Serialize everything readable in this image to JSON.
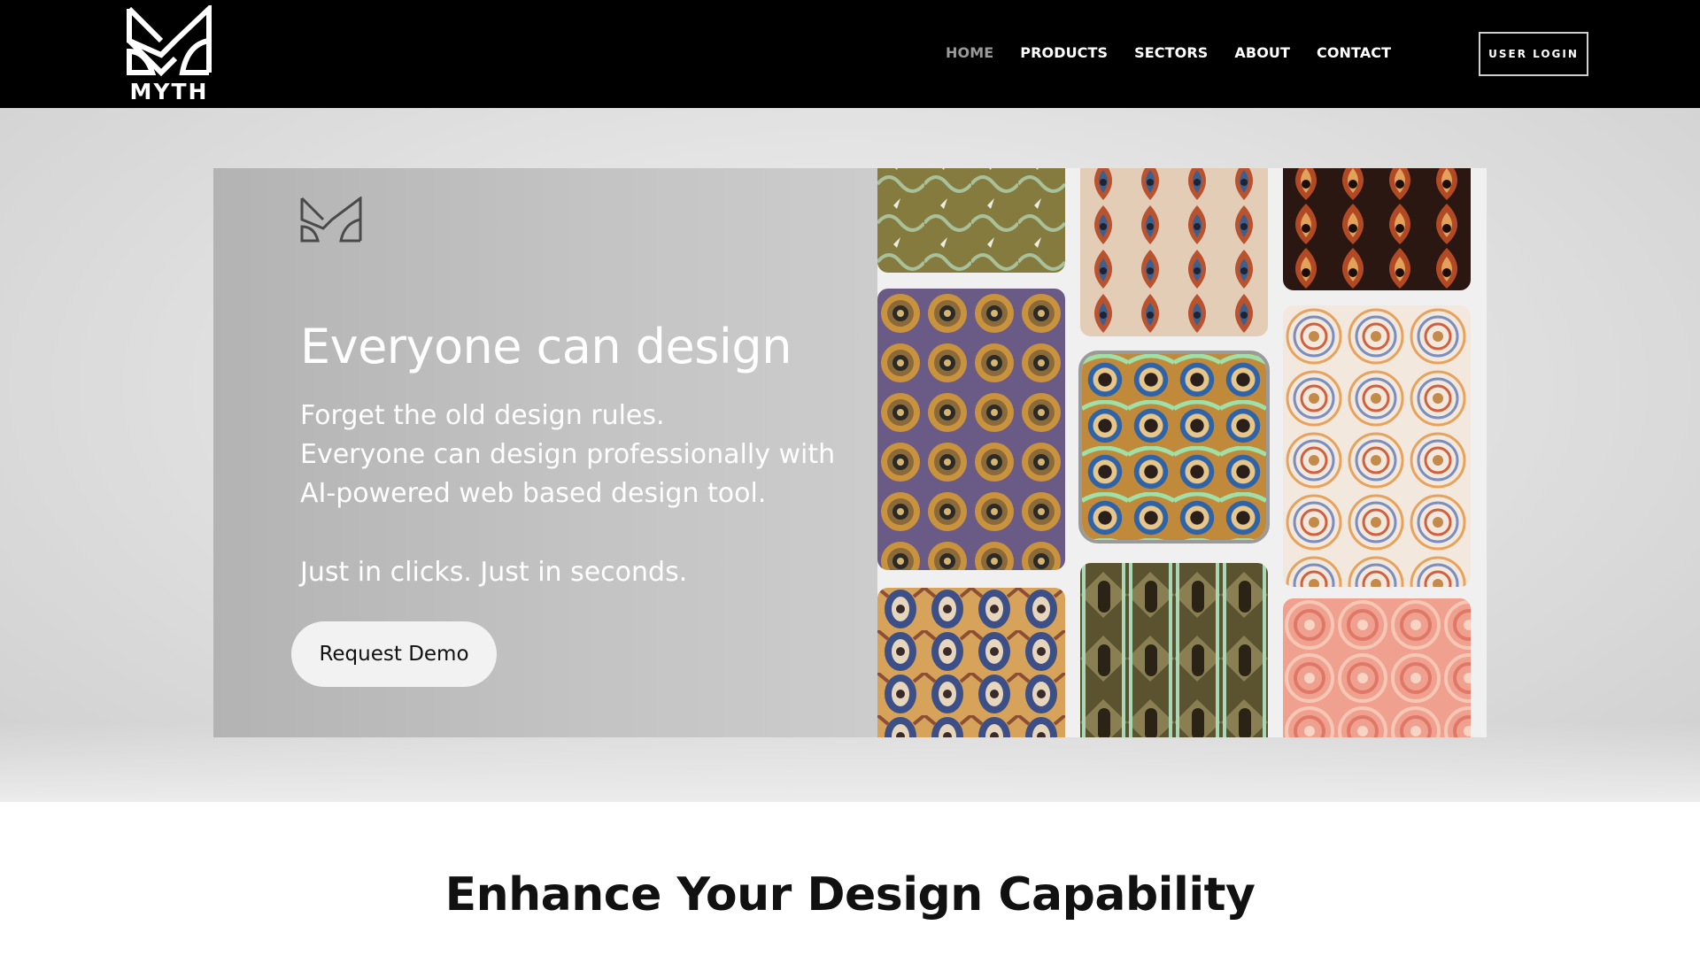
{
  "brand": {
    "name": "MYTH"
  },
  "nav": {
    "items": [
      {
        "label": "HOME",
        "active": true
      },
      {
        "label": "PRODUCTS",
        "active": false
      },
      {
        "label": "SECTORS",
        "active": false
      },
      {
        "label": "ABOUT",
        "active": false
      },
      {
        "label": "CONTACT",
        "active": false
      }
    ],
    "login_label": "USER LOGIN"
  },
  "hero": {
    "title": "Everyone can design",
    "lines": [
      "Forget the old design rules.",
      "Everyone can design professionally with",
      "AI-powered web based design tool."
    ],
    "tagline": "Just in clicks. Just in seconds.",
    "cta_label": "Request Demo"
  },
  "section": {
    "title": "Enhance Your Design Capability"
  },
  "colors": {
    "header_bg": "#000000",
    "nav_active": "#9a9a9a",
    "text_dark": "#111111"
  },
  "icons": [
    "myth-logo-icon",
    "myth-mark-icon"
  ]
}
